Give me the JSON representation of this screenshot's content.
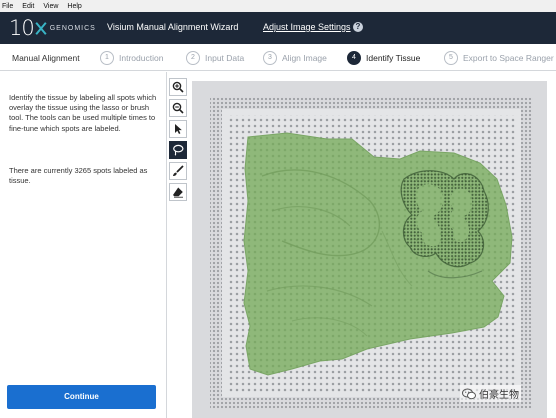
{
  "menu": [
    "File",
    "Edit",
    "View",
    "Help"
  ],
  "header": {
    "logo_number": "10",
    "logo_word": "GENOMICS",
    "app_title": "Visium Manual Alignment Wizard",
    "settings_link": "Adjust Image Settings",
    "help": "?"
  },
  "steps": {
    "section_label": "Manual Alignment",
    "items": [
      {
        "num": "1",
        "label": "Introduction"
      },
      {
        "num": "2",
        "label": "Input Data"
      },
      {
        "num": "3",
        "label": "Align Image"
      },
      {
        "num": "4",
        "label": "Identify Tissue",
        "active": true
      },
      {
        "num": "5",
        "label": "Export to Space Ranger"
      }
    ]
  },
  "panel": {
    "instructions": "Identify the tissue by labeling all spots which overlay the tissue using the lasso or brush tool. The tools can be used multiple times to fine-tune which spots are labeled.",
    "count_text": "There are currently 3265 spots labeled as tissue.",
    "continue_label": "Continue"
  },
  "tools": [
    {
      "name": "zoom-in-icon"
    },
    {
      "name": "zoom-out-icon"
    },
    {
      "name": "select-arrow-icon"
    },
    {
      "name": "lasso-icon",
      "active": true
    },
    {
      "name": "brush-icon"
    },
    {
      "name": "eraser-icon"
    }
  ],
  "watermark": "伯豪生物",
  "colors": {
    "header_bg": "#1d2838",
    "accent": "#1a6fd0",
    "tissue": "#8fb87a",
    "logo_x": "#39b4c6"
  }
}
